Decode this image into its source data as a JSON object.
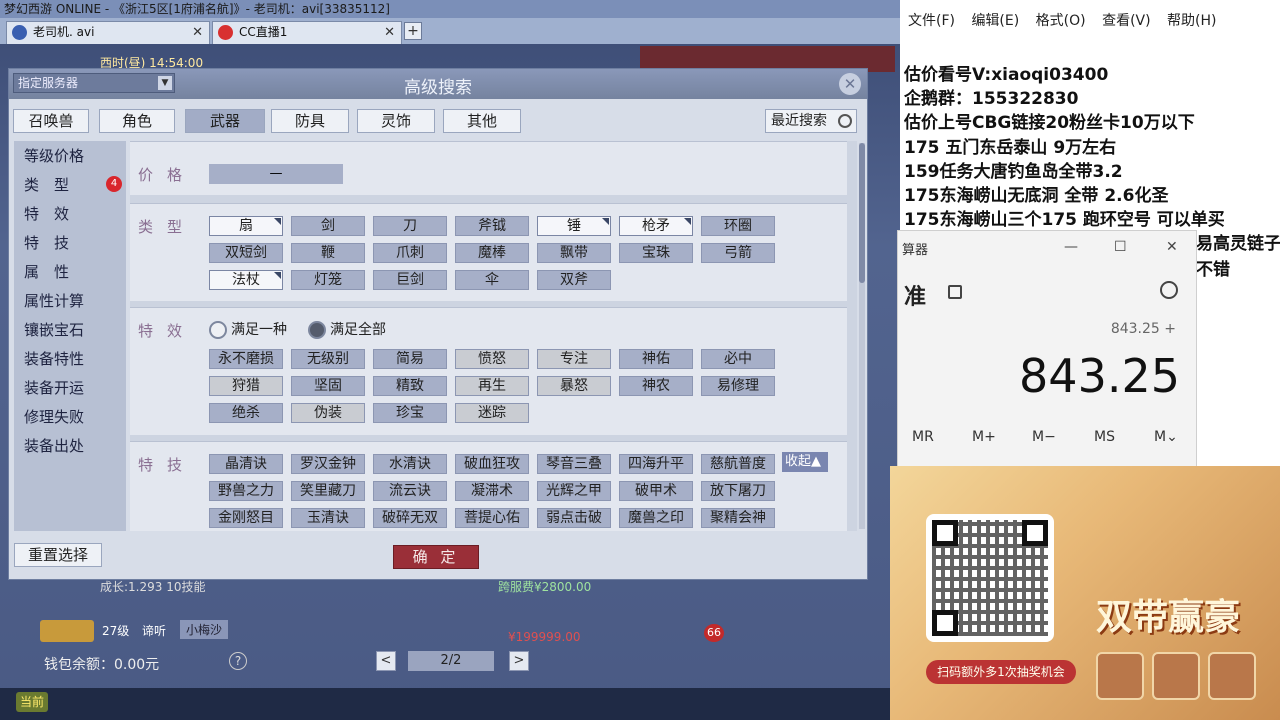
{
  "game": {
    "window_title": "梦幻西游 ONLINE - 《浙江5区[1府浦名航]》- 老司机：avi[33835112]",
    "tabs": [
      {
        "label": "老司机. avi"
      },
      {
        "label": "CC直播1"
      }
    ],
    "tab_add": "+",
    "clock": "西时(昼) 14:54:00",
    "dialog": {
      "title": "高级搜索",
      "server_select": "指定服务器",
      "close": "✕",
      "categories": [
        "召唤兽",
        "角色",
        "武器",
        "防具",
        "灵饰",
        "其他"
      ],
      "active_category": "武器",
      "recent_search": "最近搜索",
      "sidebar": [
        {
          "label": "等级价格"
        },
        {
          "label": "类　型",
          "badge": "4"
        },
        {
          "label": "特　效"
        },
        {
          "label": "特　技"
        },
        {
          "label": "属　性"
        },
        {
          "label": "属性计算"
        },
        {
          "label": "镶嵌宝石"
        },
        {
          "label": "装备特性"
        },
        {
          "label": "装备开运"
        },
        {
          "label": "修理失败"
        },
        {
          "label": "装备出处"
        }
      ],
      "price": {
        "label": "价格",
        "value": "—"
      },
      "type": {
        "label": "类型",
        "rows": [
          [
            "扇",
            "剑",
            "刀",
            "斧钺",
            "锤",
            "枪矛",
            "环圈"
          ],
          [
            "双短剑",
            "鞭",
            "爪刺",
            "魔棒",
            "飘带",
            "宝珠",
            "弓箭"
          ],
          [
            "法杖",
            "灯笼",
            "巨剑",
            "伞",
            "双斧"
          ]
        ]
      },
      "effect": {
        "label": "特效",
        "radio_any": "满足一种",
        "radio_all": "满足全部",
        "rows": [
          [
            "永不磨损",
            "无级别",
            "简易",
            "愤怒",
            "专注",
            "神佑",
            "必中"
          ],
          [
            "狩猎",
            "坚固",
            "精致",
            "再生",
            "暴怒",
            "神农",
            "易修理"
          ],
          [
            "绝杀",
            "伪装",
            "珍宝",
            "迷踪"
          ]
        ]
      },
      "skill": {
        "label": "特技",
        "collapse": "收起▲",
        "rows": [
          [
            "晶清诀",
            "罗汉金钟",
            "水清诀",
            "破血狂攻",
            "琴音三叠",
            "四海升平",
            "慈航普度"
          ],
          [
            "野兽之力",
            "笑里藏刀",
            "流云诀",
            "凝滞术",
            "光辉之甲",
            "破甲术",
            "放下屠刀"
          ],
          [
            "金刚怒目",
            "玉清诀",
            "破碎无双",
            "菩提心佑",
            "弱点击破",
            "魔兽之印",
            "聚精会神"
          ]
        ]
      },
      "reset": "重置选择",
      "confirm": "确 定"
    },
    "listing": {
      "item_name_1": "成长:1.293 10技能",
      "price_hint_1": "跨服费¥2800.00",
      "item_level": "27级",
      "item_name_2": "谛听",
      "seller": "小梅沙",
      "price_2": "¥199999.00",
      "fav_count": "66",
      "wallet": "钱包余额：0.00元",
      "help": "?",
      "page": "2/2",
      "prev": "<",
      "next": ">",
      "current_label": "当前"
    }
  },
  "notepad": {
    "menu": [
      "文件(F)",
      "编辑(E)",
      "格式(O)",
      "查看(V)",
      "帮助(H)"
    ],
    "lines": [
      "估价看号V:xiaoqi03400",
      "企鹅群：155322830",
      "估价上号CBG链接20粉丝卡10万以下",
      "175 五门东岳泰山  9万左右",
      "159任务大唐钓鱼岛全带3.2",
      "175东海崂山无底洞  全带   2.6化圣",
      "175东海崂山三个175 跑环空号 可以单买"
    ],
    "overflow_1": "易高灵链子",
    "overflow_2": "不错"
  },
  "calculator": {
    "title": "算器",
    "mode": "准",
    "expression": "843.25 +",
    "display": "843.25",
    "memory": [
      "MR",
      "M+",
      "M−",
      "MS",
      "M⌄"
    ],
    "minimize": "—",
    "maximize": "☐",
    "close": "✕"
  },
  "promo": {
    "cta": "扫码额外多1次抽奖机会",
    "headline": "双带赢豪"
  }
}
